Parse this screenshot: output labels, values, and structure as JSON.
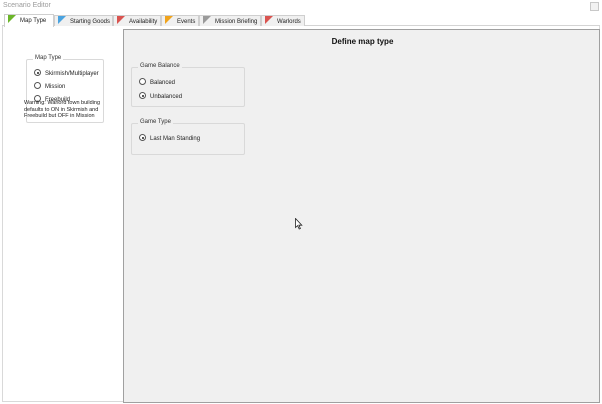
{
  "window": {
    "title": "Scenario Editor"
  },
  "tabs": [
    {
      "label": "Map Type",
      "flag_color": "#6cb52a",
      "active": true
    },
    {
      "label": "Starting Goods",
      "flag_color": "#4aa3e0",
      "active": false
    },
    {
      "label": "Availability",
      "flag_color": "#d9534f",
      "active": false
    },
    {
      "label": "Events",
      "flag_color": "#f0a31c",
      "active": false
    },
    {
      "label": "Mission Briefing",
      "flag_color": "#9a9a9a",
      "active": false
    },
    {
      "label": "Warlords",
      "flag_color": "#d9534f",
      "active": false
    }
  ],
  "map_type": {
    "legend": "Map Type",
    "options": [
      {
        "label": "Skirmish/Multiplayer",
        "checked": true
      },
      {
        "label": "Mission",
        "checked": false
      },
      {
        "label": "Freebuild",
        "checked": false
      }
    ],
    "warning": "Warning: Warlord town building defaults to ON in Skirmish and Freebuild but OFF in Mission"
  },
  "main": {
    "heading": "Define map type",
    "game_balance": {
      "legend": "Game Balance",
      "options": [
        {
          "label": "Balanced",
          "checked": false
        },
        {
          "label": "Unbalanced",
          "checked": true
        }
      ]
    },
    "game_type": {
      "legend": "Game Type",
      "options": [
        {
          "label": "Last Man Standing",
          "checked": true
        }
      ]
    }
  }
}
